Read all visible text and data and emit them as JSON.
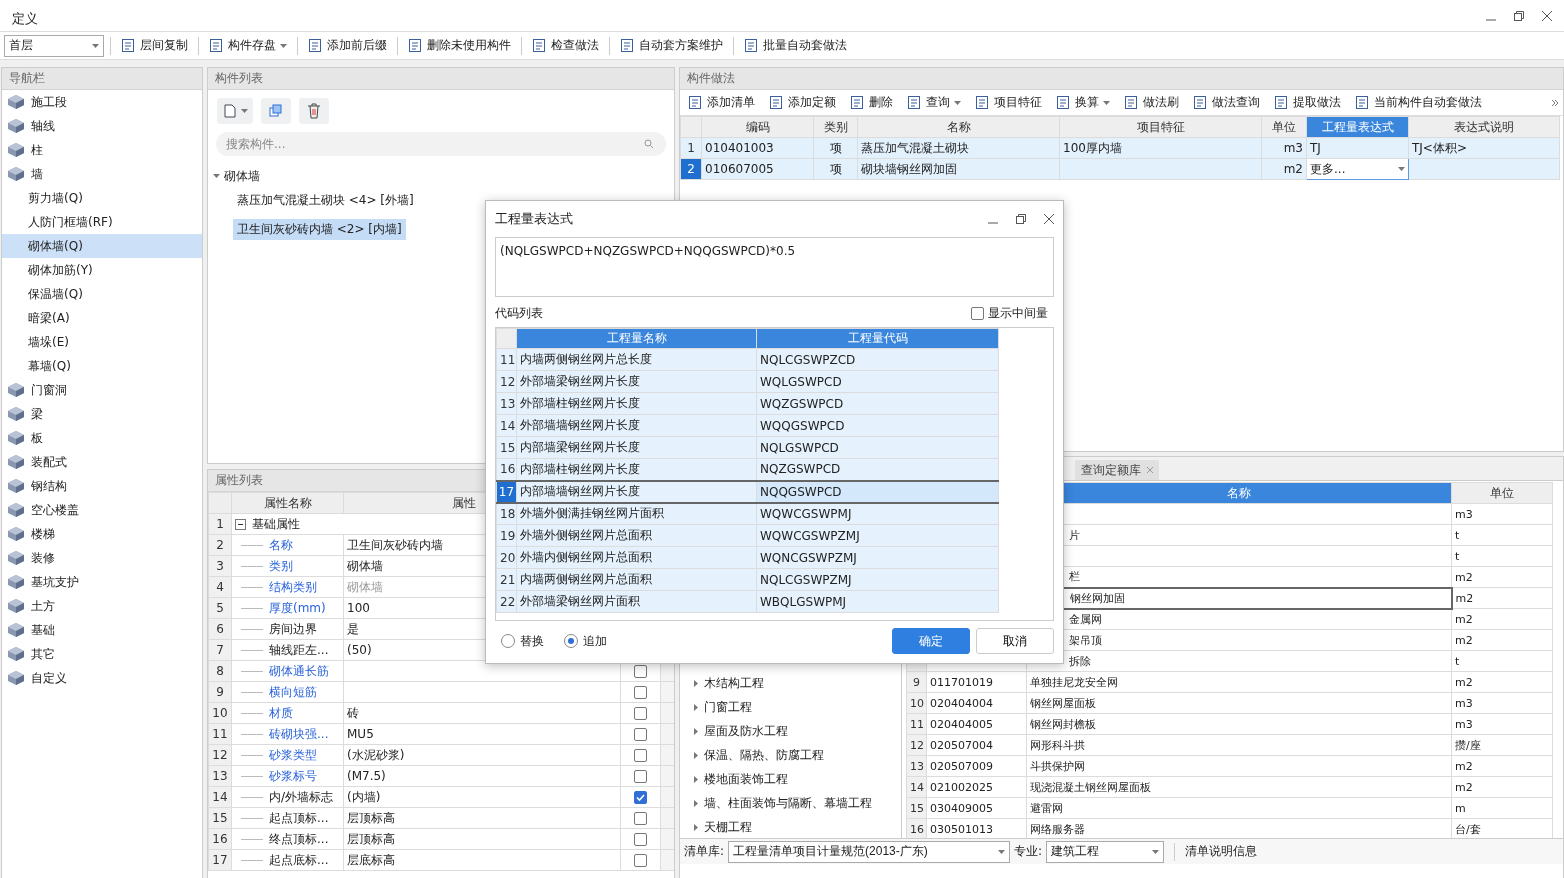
{
  "window": {
    "title": "定义"
  },
  "toolbar": {
    "floor": "首层",
    "buttons": [
      {
        "label": "层间复制",
        "dropdown": false
      },
      {
        "label": "构件存盘",
        "dropdown": true
      },
      {
        "label": "添加前后缀",
        "dropdown": false
      },
      {
        "label": "删除未使用构件",
        "dropdown": false
      },
      {
        "label": "检查做法",
        "dropdown": false
      },
      {
        "label": "自动套方案维护",
        "dropdown": false
      },
      {
        "label": "批量自动套做法",
        "dropdown": false
      }
    ]
  },
  "nav": {
    "title": "导航栏",
    "items": [
      {
        "label": "施工段",
        "kind": "category",
        "selected": false
      },
      {
        "label": "轴线",
        "kind": "category",
        "selected": false
      },
      {
        "label": "柱",
        "kind": "category",
        "selected": false
      },
      {
        "label": "墙",
        "kind": "category",
        "selected": false
      },
      {
        "label": "剪力墙(Q)",
        "kind": "sub",
        "selected": false
      },
      {
        "label": "人防门框墙(RF)",
        "kind": "sub",
        "selected": false
      },
      {
        "label": "砌体墙(Q)",
        "kind": "sub",
        "selected": true
      },
      {
        "label": "砌体加筋(Y)",
        "kind": "sub",
        "selected": false
      },
      {
        "label": "保温墙(Q)",
        "kind": "sub",
        "selected": false
      },
      {
        "label": "暗梁(A)",
        "kind": "sub",
        "selected": false
      },
      {
        "label": "墙垛(E)",
        "kind": "sub",
        "selected": false
      },
      {
        "label": "幕墙(Q)",
        "kind": "sub",
        "selected": false
      },
      {
        "label": "门窗洞",
        "kind": "category",
        "selected": false
      },
      {
        "label": "梁",
        "kind": "category",
        "selected": false
      },
      {
        "label": "板",
        "kind": "category",
        "selected": false
      },
      {
        "label": "装配式",
        "kind": "category",
        "selected": false
      },
      {
        "label": "钢结构",
        "kind": "category",
        "selected": false
      },
      {
        "label": "空心楼盖",
        "kind": "category",
        "selected": false
      },
      {
        "label": "楼梯",
        "kind": "category",
        "selected": false
      },
      {
        "label": "装修",
        "kind": "category",
        "selected": false
      },
      {
        "label": "基坑支护",
        "kind": "category",
        "selected": false
      },
      {
        "label": "土方",
        "kind": "category",
        "selected": false
      },
      {
        "label": "基础",
        "kind": "category",
        "selected": false
      },
      {
        "label": "其它",
        "kind": "category",
        "selected": false
      },
      {
        "label": "自定义",
        "kind": "category",
        "selected": false
      }
    ]
  },
  "component_list": {
    "title": "构件列表",
    "search": {
      "placeholder": "搜索构件..."
    },
    "tree": [
      {
        "label": "砌体墙",
        "expanded": true,
        "children": [
          {
            "label": "蒸压加气混凝土砌块 <4> [外墙]",
            "selected": false
          },
          {
            "label": "卫生间灰砂砖内墙 <2> [内墙]",
            "selected": true
          }
        ]
      }
    ]
  },
  "properties": {
    "title": "属性列表",
    "columns": [
      "属性名称",
      "属性"
    ],
    "rows": [
      {
        "num": "1",
        "name": "基础属性",
        "kind": "group",
        "expanded": true
      },
      {
        "num": "2",
        "name": "名称",
        "value": "卫生间灰砂砖内墙",
        "public": true
      },
      {
        "num": "3",
        "name": "类别",
        "value": "砌体墙",
        "public": true
      },
      {
        "num": "4",
        "name": "结构类别",
        "value": "砌体墙",
        "public": true,
        "dimmed": true
      },
      {
        "num": "5",
        "name": "厚度(mm)",
        "value": "100",
        "public": true
      },
      {
        "num": "6",
        "name": "房间边界",
        "value": "是",
        "public": false
      },
      {
        "num": "7",
        "name": "轴线距左...",
        "value": "(50)",
        "public": false
      },
      {
        "num": "8",
        "name": "砌体通长筋",
        "public": true,
        "checked": false
      },
      {
        "num": "9",
        "name": "横向短筋",
        "public": true,
        "checked": false
      },
      {
        "num": "10",
        "name": "材质",
        "value": "砖",
        "public": true,
        "checked": false
      },
      {
        "num": "11",
        "name": "砖砌块强...",
        "value": "MU5",
        "public": true,
        "checked": false
      },
      {
        "num": "12",
        "name": "砂浆类型",
        "value": "(水泥砂浆)",
        "public": true,
        "checked": false
      },
      {
        "num": "13",
        "name": "砂浆标号",
        "value": "(M7.5)",
        "public": true,
        "checked": false
      },
      {
        "num": "14",
        "name": "内/外墙标志",
        "value": "(内墙)",
        "public": false,
        "checked": true
      },
      {
        "num": "15",
        "name": "起点顶标...",
        "value": "层顶标高",
        "public": false,
        "checked": false
      },
      {
        "num": "16",
        "name": "终点顶标...",
        "value": "层顶标高",
        "public": false,
        "checked": false
      },
      {
        "num": "17",
        "name": "起点底标...",
        "value": "层底标高",
        "public": false,
        "checked": false
      }
    ]
  },
  "methods": {
    "title": "构件做法",
    "toolbar": [
      {
        "label": "添加清单",
        "dropdown": false
      },
      {
        "label": "添加定额",
        "dropdown": false
      },
      {
        "label": "删除",
        "dropdown": false
      },
      {
        "label": "查询",
        "dropdown": true
      },
      {
        "label": "项目特征",
        "dropdown": false
      },
      {
        "label": "换算",
        "dropdown": true
      },
      {
        "label": "做法刷",
        "dropdown": false
      },
      {
        "label": "做法查询",
        "dropdown": false
      },
      {
        "label": "提取做法",
        "dropdown": false
      },
      {
        "label": "当前构件自动套做法",
        "dropdown": false
      }
    ],
    "columns": [
      {
        "label": "编码",
        "selected": false
      },
      {
        "label": "类别",
        "selected": false
      },
      {
        "label": "名称",
        "selected": false
      },
      {
        "label": "项目特征",
        "selected": false
      },
      {
        "label": "单位",
        "selected": false
      },
      {
        "label": "工程量表达式",
        "selected": true
      },
      {
        "label": "表达式说明",
        "selected": false
      }
    ],
    "rows": [
      {
        "num": "1",
        "selected": false,
        "code": "010401003",
        "type": "项",
        "name": "蒸压加气混凝土砌块",
        "feature": "100厚内墙",
        "unit": "m3",
        "expression": "TJ",
        "explanation": "TJ<体积>"
      },
      {
        "num": "2",
        "selected": true,
        "code": "010607005",
        "type": "项",
        "name": "砌块墙钢丝网加固",
        "unit": "m2",
        "expression": "更多...",
        "editing": true
      }
    ]
  },
  "library": {
    "tabs": [
      {
        "label": "查询定额库",
        "closable": true
      }
    ],
    "tree": [
      {
        "label": "木结构工程",
        "expanded": false
      },
      {
        "label": "门窗工程",
        "expanded": false
      },
      {
        "label": "屋面及防水工程",
        "expanded": false
      },
      {
        "label": "保温、隔热、防腐工程",
        "expanded": false
      },
      {
        "label": "楼地面装饰工程",
        "expanded": false
      },
      {
        "label": "墙、柱面装饰与隔断、幕墙工程",
        "expanded": false
      },
      {
        "label": "天棚工程",
        "expanded": false
      }
    ],
    "columns": [
      "名称",
      "单位"
    ],
    "rows": [
      {
        "unit": "m3",
        "selected": false
      },
      {
        "name": "片",
        "unit": "t",
        "selected": false
      },
      {
        "unit": "t",
        "selected": false
      },
      {
        "name": "栏",
        "unit": "m2",
        "selected": false
      },
      {
        "name": "钢丝网加固",
        "unit": "m2",
        "selected": true
      },
      {
        "name": "金属网",
        "unit": "m2",
        "selected": false
      },
      {
        "name": "架吊顶",
        "unit": "m2",
        "selected": false
      },
      {
        "name": "拆除",
        "unit": "t",
        "selected": false
      },
      {
        "num": "9",
        "code": "011701019",
        "name": "单独挂尼龙安全网",
        "unit": "m2",
        "selected": false
      },
      {
        "num": "10",
        "code": "020404004",
        "name": "钢丝网屋面板",
        "unit": "m3",
        "selected": false
      },
      {
        "num": "11",
        "code": "020404005",
        "name": "钢丝网封檐板",
        "unit": "m3",
        "selected": false
      },
      {
        "num": "12",
        "code": "020507004",
        "name": "网形科斗拱",
        "unit": "攒/座",
        "selected": false
      },
      {
        "num": "13",
        "code": "020507009",
        "name": "斗拱保护网",
        "unit": "m2",
        "selected": false
      },
      {
        "num": "14",
        "code": "021002025",
        "name": "现浇混凝土钢丝网屋面板",
        "unit": "m2",
        "selected": false
      },
      {
        "num": "15",
        "code": "030409005",
        "name": "避雷网",
        "unit": "m",
        "selected": false
      },
      {
        "num": "16",
        "code": "030501013",
        "name": "网络服务器",
        "unit": "台/套",
        "selected": false
      }
    ],
    "footer": {
      "library_label": "清单库:",
      "library": "工程量清单项目计量规范(2013-广东)",
      "specialty_label": "专业:",
      "specialty": "建筑工程",
      "info": "清单说明信息"
    }
  },
  "dialog": {
    "title": "工程量表达式",
    "expression": "(NQLGSWPCD+NQZGSWPCD+NQQGSWPCD)*0.5",
    "code_list_label": "代码列表",
    "show_intermediate": {
      "label": "显示中间量",
      "checked": false
    },
    "columns": [
      "工程量名称",
      "工程量代码"
    ],
    "rows": [
      {
        "num": "11",
        "name": "内墙两侧钢丝网片总长度",
        "code": "NQLCGSWPZCD",
        "selected": false
      },
      {
        "num": "12",
        "name": "外部墙梁钢丝网片长度",
        "code": "WQLGSWPCD",
        "selected": false
      },
      {
        "num": "13",
        "name": "外部墙柱钢丝网片长度",
        "code": "WQZGSWPCD",
        "selected": false
      },
      {
        "num": "14",
        "name": "外部墙墙钢丝网片长度",
        "code": "WQQGSWPCD",
        "selected": false
      },
      {
        "num": "15",
        "name": "内部墙梁钢丝网片长度",
        "code": "NQLGSWPCD",
        "selected": false
      },
      {
        "num": "16",
        "name": "内部墙柱钢丝网片长度",
        "code": "NQZGSWPCD",
        "selected": false
      },
      {
        "num": "17",
        "name": "内部墙墙钢丝网片长度",
        "code": "NQQGSWPCD",
        "selected": true
      },
      {
        "num": "18",
        "name": "外墙外侧满挂钢丝网片面积",
        "code": "WQWCGSWPMJ",
        "selected": false
      },
      {
        "num": "19",
        "name": "外墙外侧钢丝网片总面积",
        "code": "WQWCGSWPZMJ",
        "selected": false
      },
      {
        "num": "20",
        "name": "外墙内侧钢丝网片总面积",
        "code": "WQNCGSWPZMJ",
        "selected": false
      },
      {
        "num": "21",
        "name": "内墙两侧钢丝网片总面积",
        "code": "NQLCGSWPZMJ",
        "selected": false
      },
      {
        "num": "22",
        "name": "外部墙梁钢丝网片面积",
        "code": "WBQLGSWPMJ",
        "selected": false
      }
    ],
    "modes": [
      {
        "label": "替换",
        "selected": false
      },
      {
        "label": "追加",
        "selected": true
      }
    ],
    "buttons": [
      {
        "label": "确定",
        "kind": "primary"
      },
      {
        "label": "取消",
        "kind": "secondary"
      }
    ]
  }
}
